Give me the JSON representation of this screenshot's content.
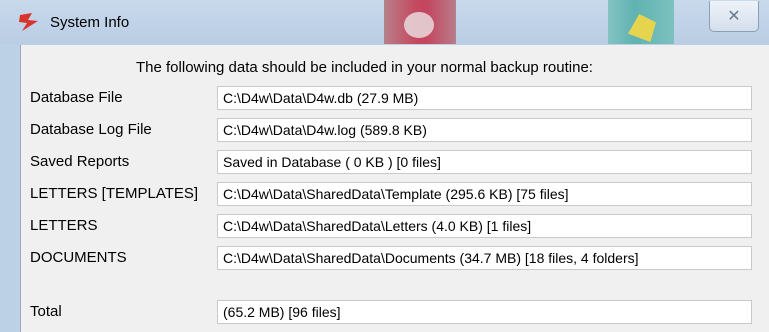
{
  "window": {
    "title": "System Info",
    "close_glyph": "✕"
  },
  "headline": "The following data should be included in your normal backup routine:",
  "rows": [
    {
      "label": "Database File",
      "value": "C:\\D4w\\Data\\D4w.db  (27.9 MB)"
    },
    {
      "label": "Database Log File",
      "value": "C:\\D4w\\Data\\D4w.log  (589.8 KB)"
    },
    {
      "label": "Saved Reports",
      "value": "Saved in Database ( 0 KB ) [0 files]"
    },
    {
      "label": "LETTERS [TEMPLATES]",
      "value": "C:\\D4w\\Data\\SharedData\\Template  (295.6 KB) [75 files]"
    },
    {
      "label": "LETTERS",
      "value": "C:\\D4w\\Data\\SharedData\\Letters  (4.0 KB)  [1 files]"
    },
    {
      "label": "DOCUMENTS",
      "value": "C:\\D4w\\Data\\SharedData\\Documents  (34.7 MB)  [18 files, 4 folders]"
    }
  ],
  "total": {
    "label": "Total",
    "value": " (65.2 MB)  [96 files]"
  },
  "icons": {
    "app": "app-logo-icon",
    "close": "close-icon"
  },
  "colors": {
    "titlebar": "#c9d9ec",
    "client_background": "#f0f0f0",
    "field_background": "#ffffff"
  }
}
